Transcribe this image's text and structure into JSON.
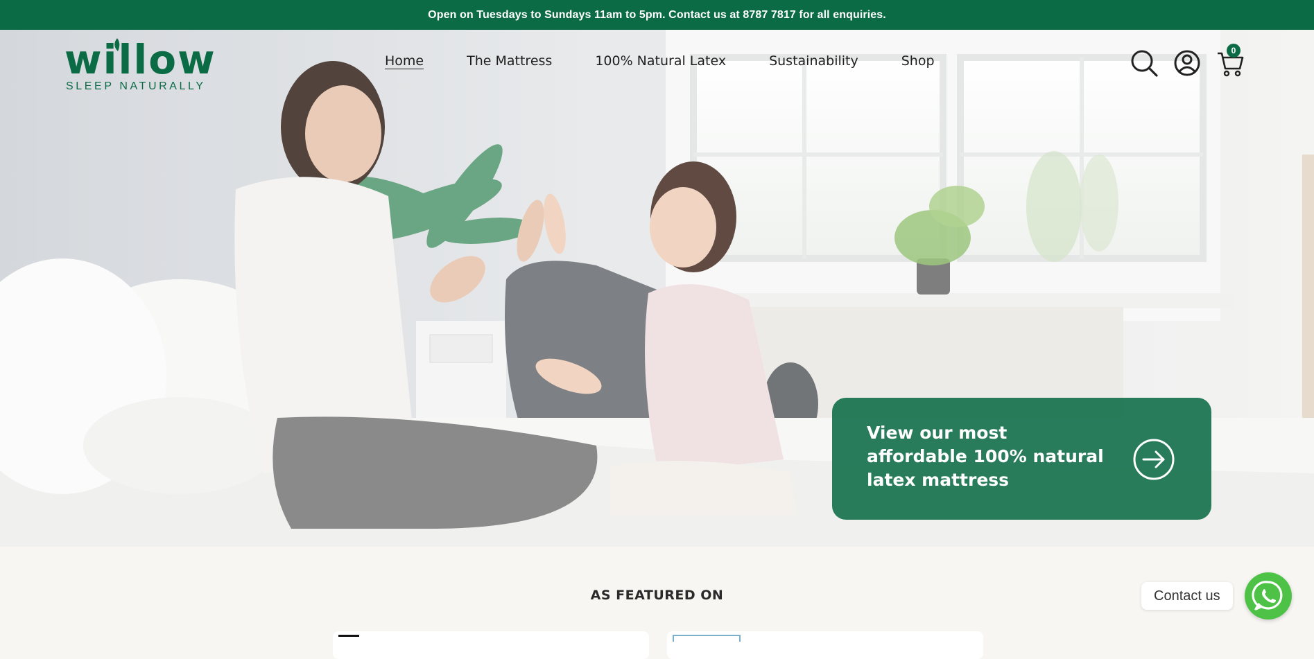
{
  "announcement": {
    "text": "Open on Tuesdays to Sundays 11am to 5pm. Contact us at 8787 7817 for all enquiries."
  },
  "brand": {
    "name": "willow",
    "tagline": "SLEEP NATURALLY",
    "color": "#0b6b45"
  },
  "nav": {
    "items": [
      {
        "label": "Home",
        "active": true
      },
      {
        "label": "The Mattress",
        "active": false
      },
      {
        "label": "100% Natural Latex",
        "active": false
      },
      {
        "label": "Sustainability",
        "active": false
      },
      {
        "label": "Shop",
        "active": false
      }
    ]
  },
  "header_icons": {
    "search": "search-icon",
    "account": "account-icon",
    "cart": "cart-icon",
    "cart_count": "0"
  },
  "hero": {
    "image": "mother and daughter high-fiving on bed in bright bedroom",
    "cta_text": "View our most affordable 100% natural latex mattress",
    "cta_icon": "arrow-right-circle-icon"
  },
  "featured": {
    "title": "AS FEATURED ON"
  },
  "contact": {
    "label": "Contact us",
    "icon": "whatsapp-icon",
    "color": "#4dc247"
  }
}
